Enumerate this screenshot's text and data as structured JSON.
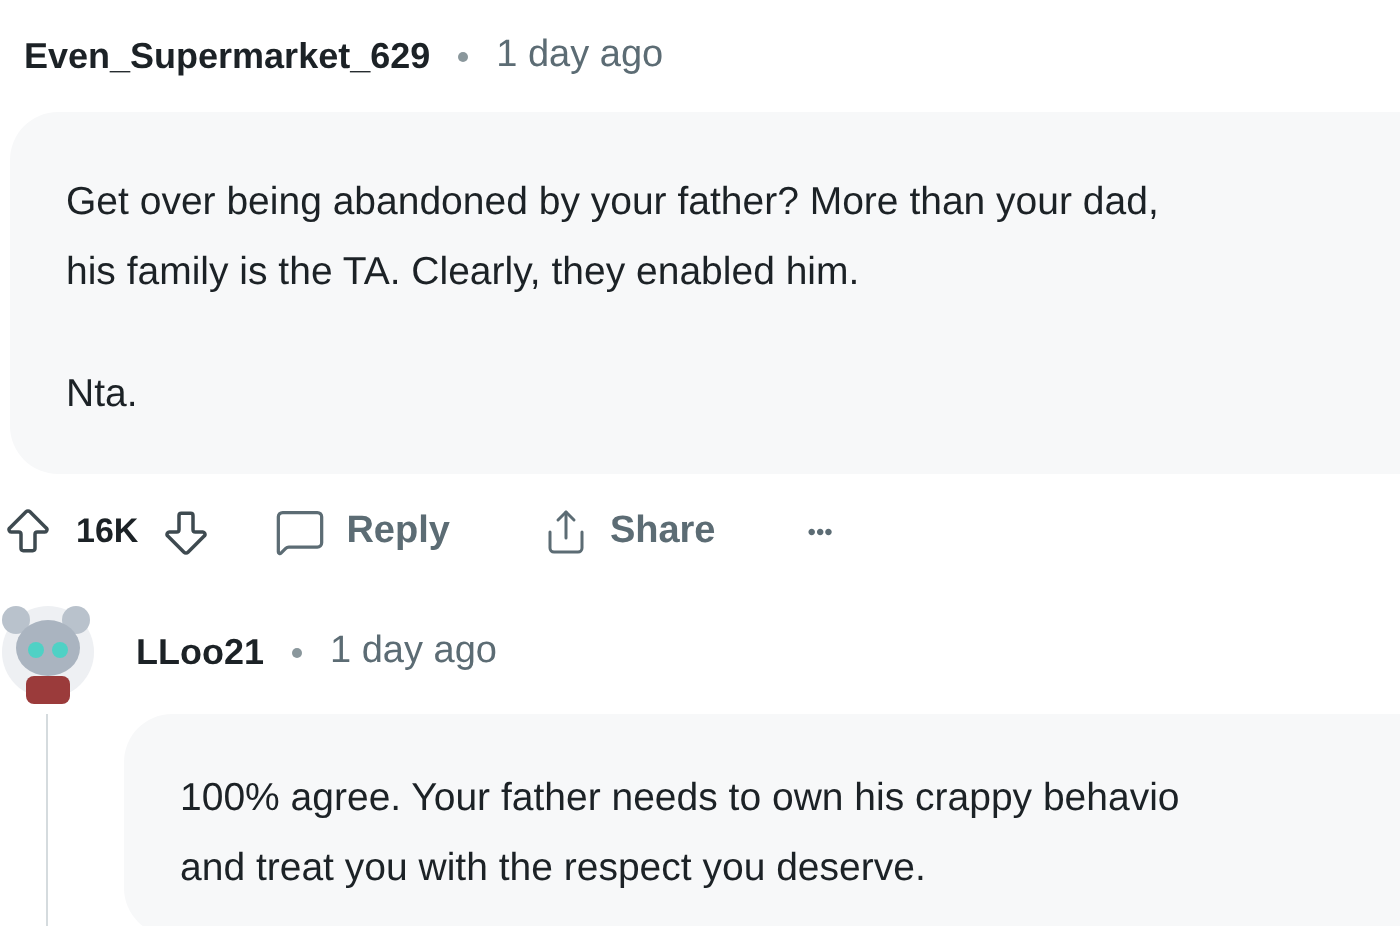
{
  "comments": [
    {
      "author": "Even_Supermarket_629",
      "time": "1 day ago",
      "avatar": false,
      "paragraphs": [
        [
          "Get over being abandoned by your father? More than your dad,",
          "his family is the TA. Clearly, they enabled him."
        ],
        [
          "Nta."
        ]
      ],
      "actions": {
        "score": "16K",
        "reply": "Reply",
        "share": "Share",
        "more": "•••"
      }
    },
    {
      "author": "LLoo21",
      "time": "1 day ago",
      "avatar": true,
      "paragraphs": [
        [
          "100% agree. Your father needs to own his crappy behavio",
          "and treat you with the respect you deserve."
        ]
      ]
    }
  ]
}
